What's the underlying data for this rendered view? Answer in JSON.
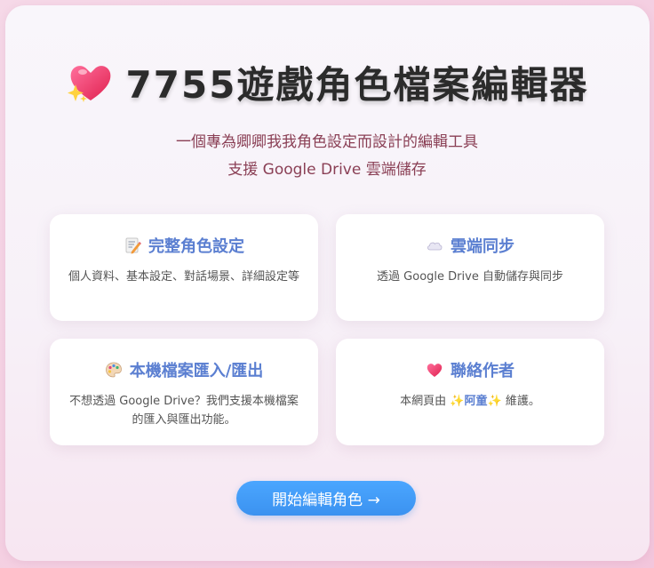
{
  "header": {
    "title": "7755遊戲角色檔案編輯器",
    "subtitle_line1": "一個專為卿卿我我角色設定而設計的編輯工具",
    "subtitle_line2": "支援 Google Drive 雲端儲存"
  },
  "features": [
    {
      "icon": "memo-icon",
      "title": "完整角色設定",
      "description": "個人資料、基本設定、對話場景、詳細設定等"
    },
    {
      "icon": "cloud-icon",
      "title": "雲端同步",
      "description": "透過 Google Drive 自動儲存與同步"
    },
    {
      "icon": "palette-icon",
      "title": "本機檔案匯入/匯出",
      "description": "不想透過 Google Drive？我們支援本機檔案的匯入與匯出功能。"
    },
    {
      "icon": "heart-icon",
      "title": "聯絡作者",
      "description_prefix": "本網頁由",
      "author": "✨阿童✨",
      "description_suffix": "維護。"
    }
  ],
  "start_button": {
    "label": "開始編輯角色 →"
  },
  "colors": {
    "accent": "#5b7fd1",
    "button": "#3f9af5",
    "subtitle": "#8a3f55"
  }
}
